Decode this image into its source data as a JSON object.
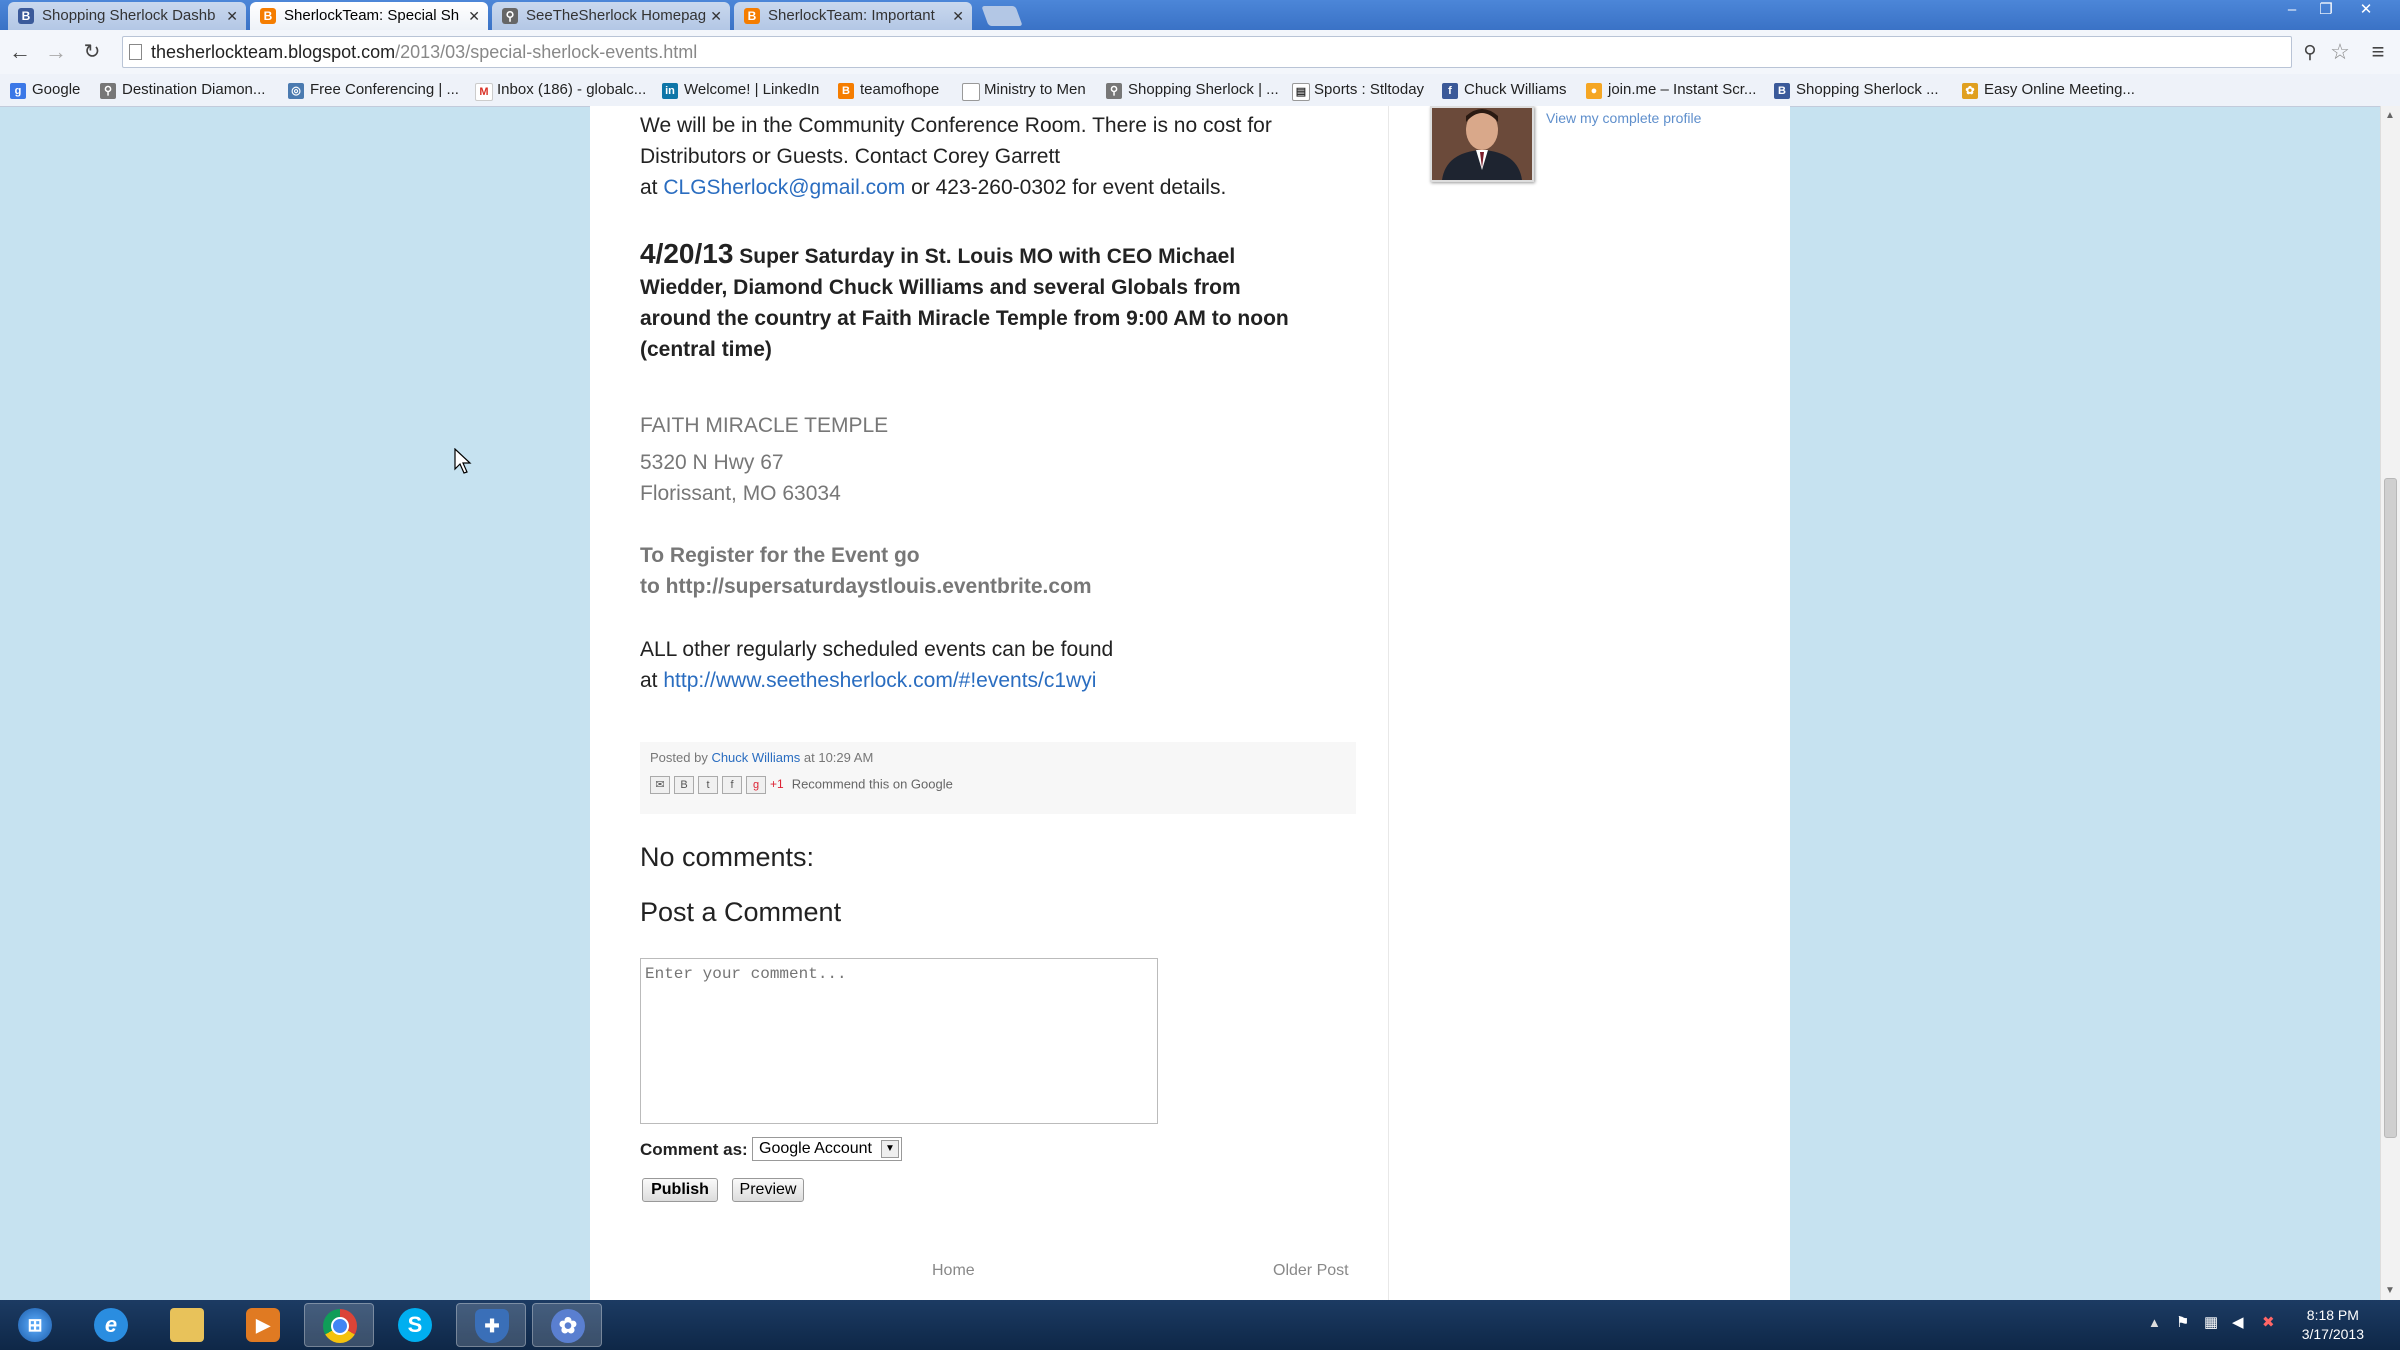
{
  "browser": {
    "tabs": [
      {
        "label": "Shopping Sherlock Dashb",
        "icon": "blogger-icon",
        "color": "#3b5a9a"
      },
      {
        "label": "SherlockTeam: Special Sh",
        "icon": "blogger-icon",
        "color": "#f57d00"
      },
      {
        "label": "SeeTheSherlock Homepag",
        "icon": "sherlock-icon",
        "color": "#666666"
      },
      {
        "label": "SherlockTeam: Important",
        "icon": "blogger-icon",
        "color": "#f57d00"
      }
    ],
    "url_host": "thesherlockteam.blogspot.com",
    "url_path": "/2013/03/special-sherlock-events.html",
    "bookmarks": [
      {
        "label": "Google",
        "icon": "google-icon"
      },
      {
        "label": "Destination Diamon...",
        "icon": "sherlock-icon"
      },
      {
        "label": "Free Conferencing | ...",
        "icon": "conference-icon"
      },
      {
        "label": "Inbox (186) - globalc...",
        "icon": "gmail-icon"
      },
      {
        "label": "Welcome! | LinkedIn",
        "icon": "linkedin-icon"
      },
      {
        "label": "teamofhope",
        "icon": "blogger-icon"
      },
      {
        "label": "Ministry to Men",
        "icon": "page-icon"
      },
      {
        "label": "Shopping Sherlock | ...",
        "icon": "sherlock-icon"
      },
      {
        "label": "Sports : Stltoday",
        "icon": "news-icon"
      },
      {
        "label": "Chuck Williams",
        "icon": "facebook-icon"
      },
      {
        "label": "join.me – Instant Scr...",
        "icon": "joinme-icon"
      },
      {
        "label": "Shopping Sherlock ...",
        "icon": "sherlock-icon"
      },
      {
        "label": "Easy Online Meeting...",
        "icon": "meeting-icon"
      }
    ]
  },
  "post": {
    "intro_line1": "We will be in the Community Conference Room.  There is no cost for",
    "intro_line2": "Distributors or Guests.  Contact Corey Garrett",
    "intro_at": "at ",
    "email": "CLGSherlock@gmail.com",
    "intro_tail": " or 423-260-0302 for event details.",
    "event_date": "4/20/13",
    "event_line1": " Super Saturday in St. Louis MO with CEO Michael",
    "event_line2": "Wiedder, Diamond Chuck Williams and several Globals from",
    "event_line3": "around the country at Faith Miracle Temple from 9:00 AM to noon",
    "event_line4": "(central time)",
    "venue_name": "FAITH MIRACLE TEMPLE",
    "venue_street": "5320 N Hwy 67",
    "venue_city": "Florissant, MO 63034",
    "register_line1": "To Register for the Event go",
    "register_line2": "to http://supersaturdaystlouis.eventbrite.com",
    "other_line1": "ALL other regularly scheduled events can be found",
    "other_at": "at ",
    "other_link": "http://www.seethesherlock.com/#!events/c1wyi",
    "posted_by": "Posted by ",
    "author": "Chuck Williams",
    "posted_at": " at 10:29 AM",
    "recommend": "Recommend this on Google",
    "plus_one": "+1"
  },
  "comments": {
    "no_comments": "No comments:",
    "post_heading": "Post a Comment",
    "placeholder": "Enter your comment...",
    "comment_as_label": "Comment as:",
    "comment_as_value": "Google Account",
    "publish": "Publish",
    "preview": "Preview"
  },
  "footer": {
    "home": "Home",
    "older": "Older Post"
  },
  "sidebar": {
    "profile_link": "View my complete profile"
  },
  "taskbar": {
    "time": "8:18 PM",
    "date": "3/17/2013"
  }
}
